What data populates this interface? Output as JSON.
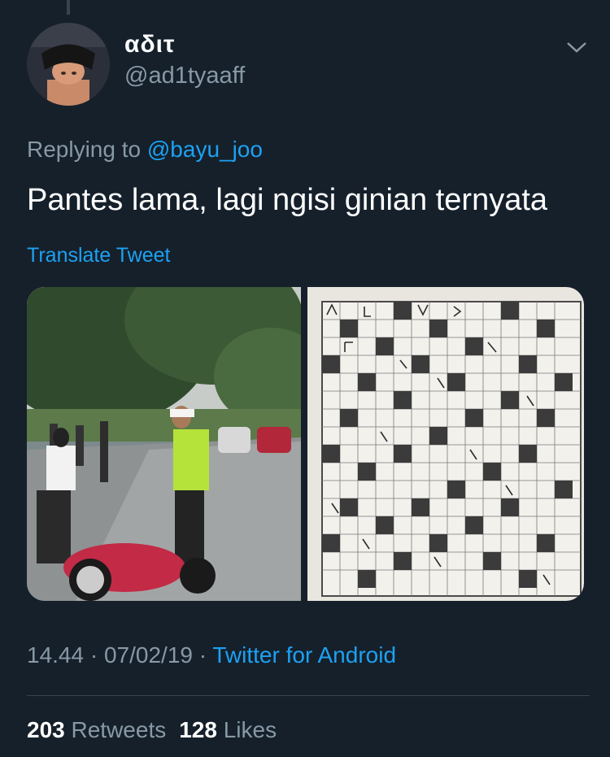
{
  "tweet": {
    "display_name": "αδιτ",
    "handle": "@ad1tyaaff",
    "replying_prefix": "Replying to ",
    "replying_to": "@bayu_joo",
    "text": "Pantes lama, lagi ngisi ginian ternyata",
    "translate_label": "Translate Tweet",
    "time": "14.44",
    "sep1": " · ",
    "date": "07/02/19",
    "sep2": " · ",
    "source": "Twitter for Android",
    "retweets_count": "203",
    "retweets_label": "Retweets",
    "likes_count": "128",
    "likes_label": "Likes"
  },
  "icons": {
    "menu": "chevron-down-icon"
  },
  "colors": {
    "background": "#15202b",
    "accent": "#1da1f2",
    "secondary_text": "#8899a6",
    "divider": "#38444d"
  }
}
